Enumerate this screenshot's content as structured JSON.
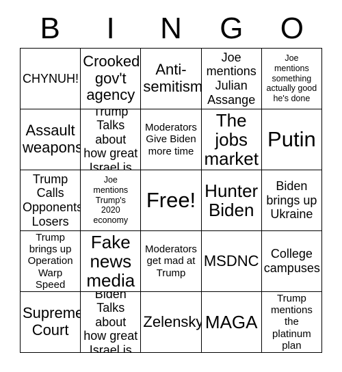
{
  "header": {
    "letters": [
      "B",
      "I",
      "N",
      "G",
      "O"
    ]
  },
  "colors": {
    "background": "#ffffff",
    "text": "#000000",
    "grid_line": "#000000"
  },
  "grid": {
    "columns": 5,
    "rows": 5,
    "cells": [
      {
        "text": "CHYNUH!",
        "size": "md"
      },
      {
        "text": "Crooked\ngov't\nagency",
        "size": "lg"
      },
      {
        "text": "Anti-\nsemitism",
        "size": "lg"
      },
      {
        "text": "Joe\nmentions\nJulian\nAssange",
        "size": "md"
      },
      {
        "text": "Joe\nmentions\nsomething\nactually good\nhe's done",
        "size": "xs"
      },
      {
        "text": "Assault\nweapons",
        "size": "lg"
      },
      {
        "text": "Trump\nTalks about\nhow great\nIsrael is",
        "size": "md"
      },
      {
        "text": "Moderators\nGive Biden\nmore time",
        "size": "sm"
      },
      {
        "text": "The\njobs\nmarket",
        "size": "xl"
      },
      {
        "text": "Putin",
        "size": "xxl"
      },
      {
        "text": "Trump\nCalls\nOpponents\nLosers",
        "size": "md"
      },
      {
        "text": "Joe\nmentions\nTrump's\n2020\neconomy",
        "size": "xs"
      },
      {
        "text": "Free!",
        "size": "xxl"
      },
      {
        "text": "Hunter\nBiden",
        "size": "xl"
      },
      {
        "text": "Biden\nbrings up\nUkraine",
        "size": "md"
      },
      {
        "text": "Trump\nbrings up\nOperation\nWarp Speed",
        "size": "sm"
      },
      {
        "text": "Fake\nnews\nmedia",
        "size": "xl"
      },
      {
        "text": "Moderators\nget mad at\nTrump",
        "size": "sm"
      },
      {
        "text": "MSDNC",
        "size": "lg"
      },
      {
        "text": "College\ncampuses",
        "size": "md"
      },
      {
        "text": "Supreme\nCourt",
        "size": "lg"
      },
      {
        "text": "Biden\nTalks about\nhow great\nIsrael is",
        "size": "md"
      },
      {
        "text": "Zelensky",
        "size": "lg"
      },
      {
        "text": "MAGA",
        "size": "xl"
      },
      {
        "text": "Trump\nmentions\nthe platinum\nplan",
        "size": "sm"
      }
    ]
  }
}
